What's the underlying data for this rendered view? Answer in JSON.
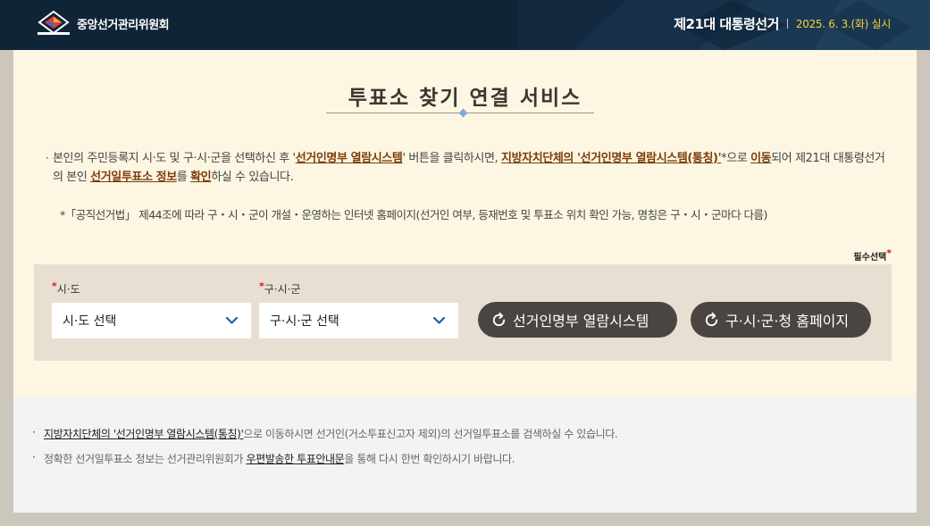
{
  "header": {
    "org_name": "중앙선거관리위원회",
    "election_title": "제21대 대통령선거",
    "election_date": "2025. 6. 3.(화) 실시",
    "colors": {
      "bg": "#0f2437",
      "date": "#f5cf3c"
    }
  },
  "main": {
    "title": "투표소 찾기 연결 서비스",
    "desc": {
      "t1": "본인의 주민등록지 시·도 및 구·시·군을 선택하신 후 '",
      "h1": "선거인명부 열람시스템",
      "t2": "' 버튼을 클릭하시면, ",
      "h2": "지방자치단체의 '선거인명부 열람시스템(통칭)'",
      "t3": "*으로 ",
      "h3": "이동",
      "t4": "되어 제21대 대통령선거의 본인 ",
      "h4": "선거일투표소 정보",
      "t5": "를 ",
      "h5": "확인",
      "t6": "하실 수 있습니다."
    },
    "note": "*「공직선거법」 제44조에 따라 구・시・군이 개설・운영하는 인터넷 홈페이지(선거인 여부, 등재번호 및 투표소 위치 확인 가능, 명칭은 구・시・군마다 다름)",
    "required_label": "필수선택",
    "form": {
      "sido_label": "시·도",
      "sido_value": "시·도 선택",
      "gusigun_label": "구·시·군",
      "gusigun_value": "구·시·군 선택",
      "btn_register": "선거인명부 열람시스템",
      "btn_homepage": "구·시·군·청 홈페이지"
    }
  },
  "bottom": {
    "line1_link": "지방자치단체의 '선거인명부 열람시스템(통칭)'",
    "line1_rest": "으로 이동하시면 선거인(거소투표신고자 제외)의 선거일투표소를 검색하실 수 있습니다.",
    "line2_a": "정확한 선거일투표소 정보는 선거관리위원회가 ",
    "line2_link": "우편발송한 투표안내문",
    "line2_b": "을 통해 다시 한번 확인하시기 바랍니다."
  }
}
